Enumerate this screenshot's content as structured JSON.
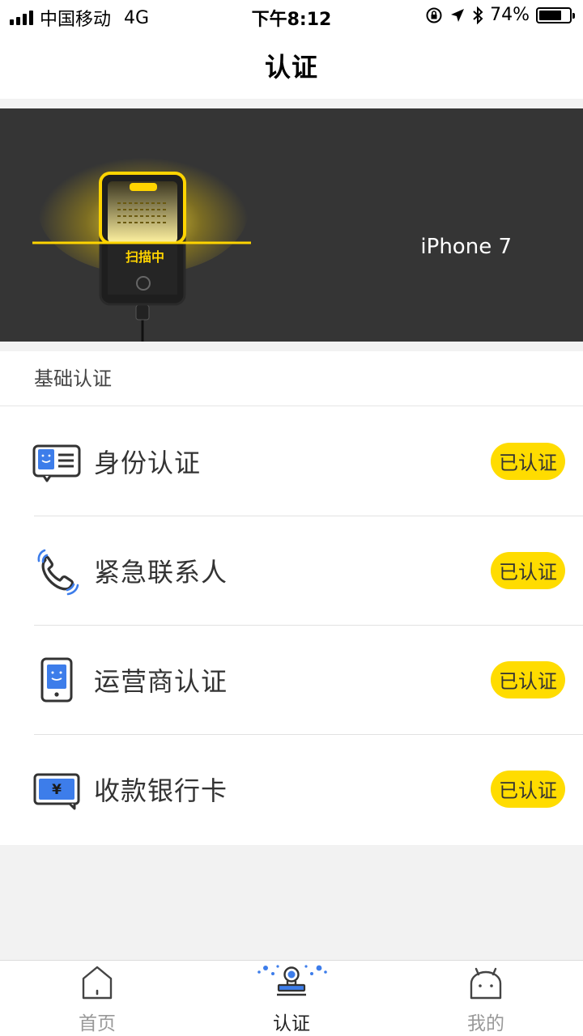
{
  "status_bar": {
    "carrier": "中国移动",
    "network": "4G",
    "time": "下午8:12",
    "battery_percent": "74%",
    "battery_level": 0.74
  },
  "nav": {
    "title": "认证"
  },
  "banner": {
    "scan_label": "扫描中",
    "device_name": "iPhone 7"
  },
  "section": {
    "title": "基础认证",
    "items": [
      {
        "label": "身份认证",
        "status": "已认证",
        "icon": "id-card-icon"
      },
      {
        "label": "紧急联系人",
        "status": "已认证",
        "icon": "phone-call-icon"
      },
      {
        "label": "运营商认证",
        "status": "已认证",
        "icon": "mobile-carrier-icon"
      },
      {
        "label": "收款银行卡",
        "status": "已认证",
        "icon": "bank-card-icon"
      }
    ]
  },
  "tabs": [
    {
      "label": "首页",
      "icon": "home-icon",
      "active": false
    },
    {
      "label": "认证",
      "icon": "verify-stamp-icon",
      "active": true
    },
    {
      "label": "我的",
      "icon": "profile-face-icon",
      "active": false
    }
  ],
  "colors": {
    "accent_yellow": "#ffdc00",
    "icon_blue": "#3d7dea",
    "banner_bg": "#353535"
  }
}
